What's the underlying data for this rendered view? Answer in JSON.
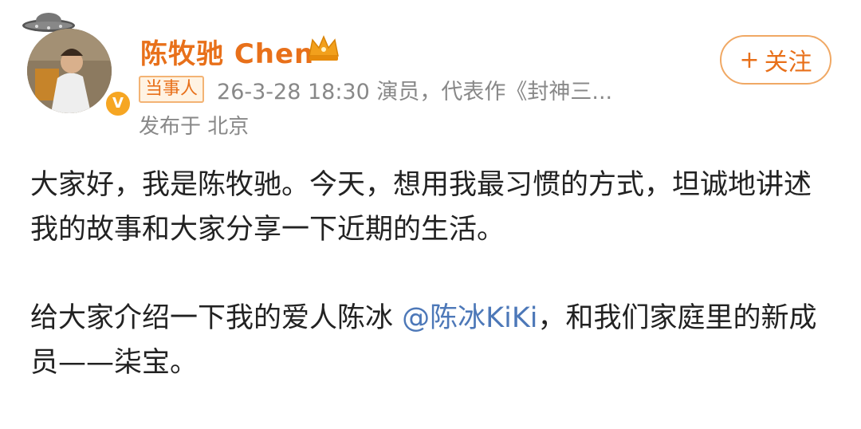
{
  "post": {
    "username": "陈牧驰 Chen",
    "badge": "当事人",
    "meta": "26-3-28 18:30  演员，代表作《封神三...",
    "location": "发布于 北京",
    "follow_label": "关注",
    "follow_plus": "+",
    "paragraphs": [
      {
        "text": "大家好，我是陈牧驰。今天，想用我最习惯的方式，坦诚地讲述我的故事和大家分享一下近期的生活。"
      },
      {
        "before": "给大家介绍一下我的爱人陈冰 ",
        "mention": "@陈冰KiKi",
        "after": "，和我们家庭里的新成员——柒宝。"
      }
    ]
  },
  "icons": {
    "ufo": "ufo-icon",
    "crown": "crown-icon",
    "verified": "verified-v-icon"
  },
  "colors": {
    "name_orange": "#e8701a",
    "mention_blue": "#4d78b8",
    "meta_gray": "#888888"
  },
  "verified_mark": "V"
}
